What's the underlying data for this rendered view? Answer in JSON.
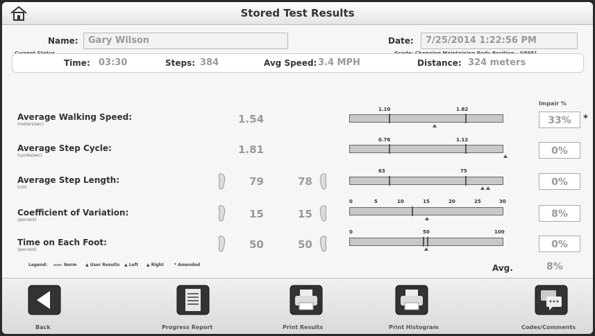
{
  "header": {
    "title": "Stored Test Results"
  },
  "name": {
    "label": "Name:",
    "value": "Gary Wilson"
  },
  "date": {
    "label": "Date:",
    "value": "7/25/2014 1:22:56 PM"
  },
  "current_status": "Current Status",
  "gcode": "Gcode: Changing Maintaining Body Position - G8981",
  "stats": {
    "time_label": "Time:",
    "time": "03:30",
    "steps_label": "Steps:",
    "steps": "384",
    "speed_label": "Avg Speed:",
    "speed": "3.4 MPH",
    "distance_label": "Distance:",
    "distance": "324 meters"
  },
  "impair_header": "Impair %",
  "metrics": [
    {
      "name": "Average Walking Speed:",
      "unit": "(meters/sec)",
      "value": "1.54",
      "impair": "33%",
      "norm_low": "1.10",
      "norm_high": "1.82",
      "amended": "*"
    },
    {
      "name": "Average Step Cycle:",
      "unit": "(cycles/sec)",
      "value": "1.81",
      "impair": "0%",
      "norm_low": "0.76",
      "norm_high": "1.12"
    },
    {
      "name": "Average Step Length:",
      "unit": "(cm)",
      "left": "79",
      "right": "78",
      "impair": "0%",
      "norm_low": "63",
      "norm_high": "75"
    },
    {
      "name": "Coefficient of Variation:",
      "unit": "(percent)",
      "left": "15",
      "right": "15",
      "impair": "8%",
      "ticks": [
        "0",
        "5",
        "10",
        "15",
        "20",
        "25",
        "30"
      ]
    },
    {
      "name": "Time on Each Foot:",
      "unit": "(percent)",
      "left": "50",
      "right": "50",
      "impair": "0%",
      "ticks": [
        "0",
        "50",
        "100"
      ]
    }
  ],
  "legend": {
    "title": "Legend:",
    "norm": "Norm",
    "user": "▲ User Results",
    "left": "▲ Left",
    "right": "▲ Right",
    "amended": "* Amended"
  },
  "avg": {
    "label": "Avg.",
    "value": "8%"
  },
  "toolbar": {
    "back": "Back",
    "progress": "Progress Report",
    "print_results": "Print Results",
    "print_histogram": "Print Histogram",
    "codes": "Codes/Comments"
  },
  "icons": [
    "home-icon",
    "back-arrow-icon",
    "report-icon",
    "printer-icon",
    "printer-icon",
    "comments-icon",
    "left-foot-icon",
    "right-foot-icon"
  ]
}
